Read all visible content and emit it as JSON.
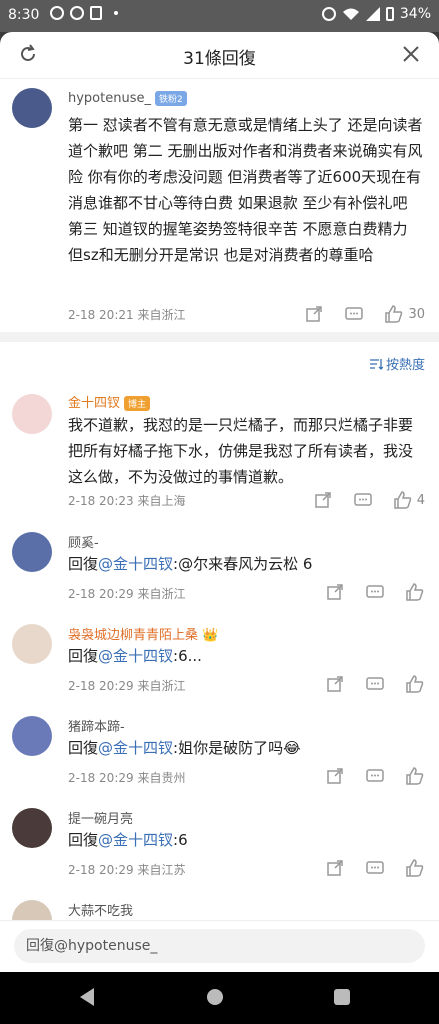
{
  "status": {
    "time": "8:30",
    "battery": "34%"
  },
  "header": {
    "title": "31條回復"
  },
  "main_comment": {
    "username": "hypotenuse_",
    "badge": "铁粉2",
    "text": "第一 怼读者不管有意无意或是情绪上头了 还是向读者道个歉吧 第二 无删出版对作者和消费者来说确实有风险 你有你的考虑没问题 但消费者等了近600天现在有消息谁都不甘心等待白费 如果退款 至少有补偿礼吧 第三 知道钗的握笔姿势签特很辛苦 不愿意白费精力 但sz和无删分开是常识 也是对消费者的尊重哈",
    "meta": "2-18 20:21 来自浙江",
    "likes": "30"
  },
  "sort_label": "按熱度",
  "replies": [
    {
      "username": "金十四钗",
      "badge": "博主",
      "text": "我不道歉，我怼的是一只烂橘子，而那只烂橘子非要把所有好橘子拖下水，仿佛是我怼了所有读者，我没这么做，不为没做过的事情道歉。",
      "meta": "2-18 20:23 来自上海",
      "likes": "4"
    },
    {
      "username": "顾奚-",
      "reply_prefix": "回復",
      "mention": "@金十四钗",
      "reply_text": ":@尔来春风为云松 6",
      "meta": "2-18 20:29 来自浙江"
    },
    {
      "username": "袅袅城边柳青青陌上桑 👑",
      "reply_prefix": "回復",
      "mention": "@金十四钗",
      "reply_text": ":6...",
      "meta": "2-18 20:29 来自浙江"
    },
    {
      "username": "猪蹄本蹄-",
      "reply_prefix": "回復",
      "mention": "@金十四钗",
      "reply_text": ":姐你是破防了吗😂",
      "meta": "2-18 20:29 来自贵州"
    },
    {
      "username": "提一碗月亮",
      "reply_prefix": "回復",
      "mention": "@金十四钗",
      "reply_text": ":6",
      "meta": "2-18 20:29 来自江苏"
    },
    {
      "username": "大蒜不吃我"
    }
  ],
  "input": {
    "placeholder": "回復@hypotenuse_"
  },
  "colors": {
    "link": "#3a6fb5",
    "author_name": "#e07a1f",
    "vip_name": "#e0702a"
  }
}
